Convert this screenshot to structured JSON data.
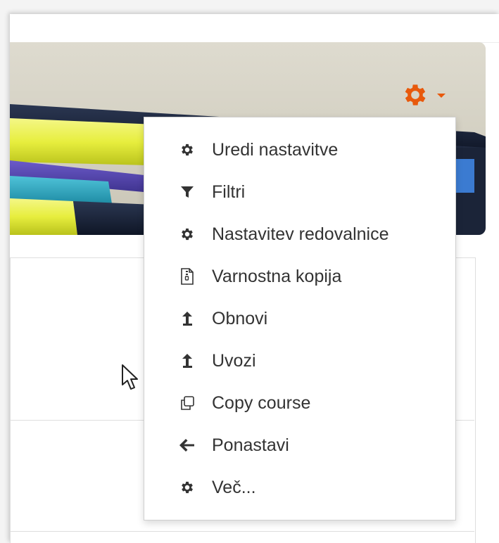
{
  "colors": {
    "accent": "#e8590c",
    "menu_text": "#333333",
    "border": "#cfcfcf"
  },
  "settings_toggle": {
    "icon": "gear-icon",
    "caret": "caret-down-icon"
  },
  "menu": {
    "items": [
      {
        "label": "Uredi nastavitve",
        "icon": "gear-icon"
      },
      {
        "label": "Filtri",
        "icon": "filter-icon"
      },
      {
        "label": "Nastavitev redovalnice",
        "icon": "gear-icon"
      },
      {
        "label": "Varnostna kopija",
        "icon": "file-archive-icon"
      },
      {
        "label": "Obnovi",
        "icon": "upload-arrow-icon"
      },
      {
        "label": "Uvozi",
        "icon": "upload-arrow-icon"
      },
      {
        "label": "Copy course",
        "icon": "copy-icon"
      },
      {
        "label": "Ponastavi",
        "icon": "arrow-left-icon"
      },
      {
        "label": "Več...",
        "icon": "gear-icon"
      }
    ]
  }
}
